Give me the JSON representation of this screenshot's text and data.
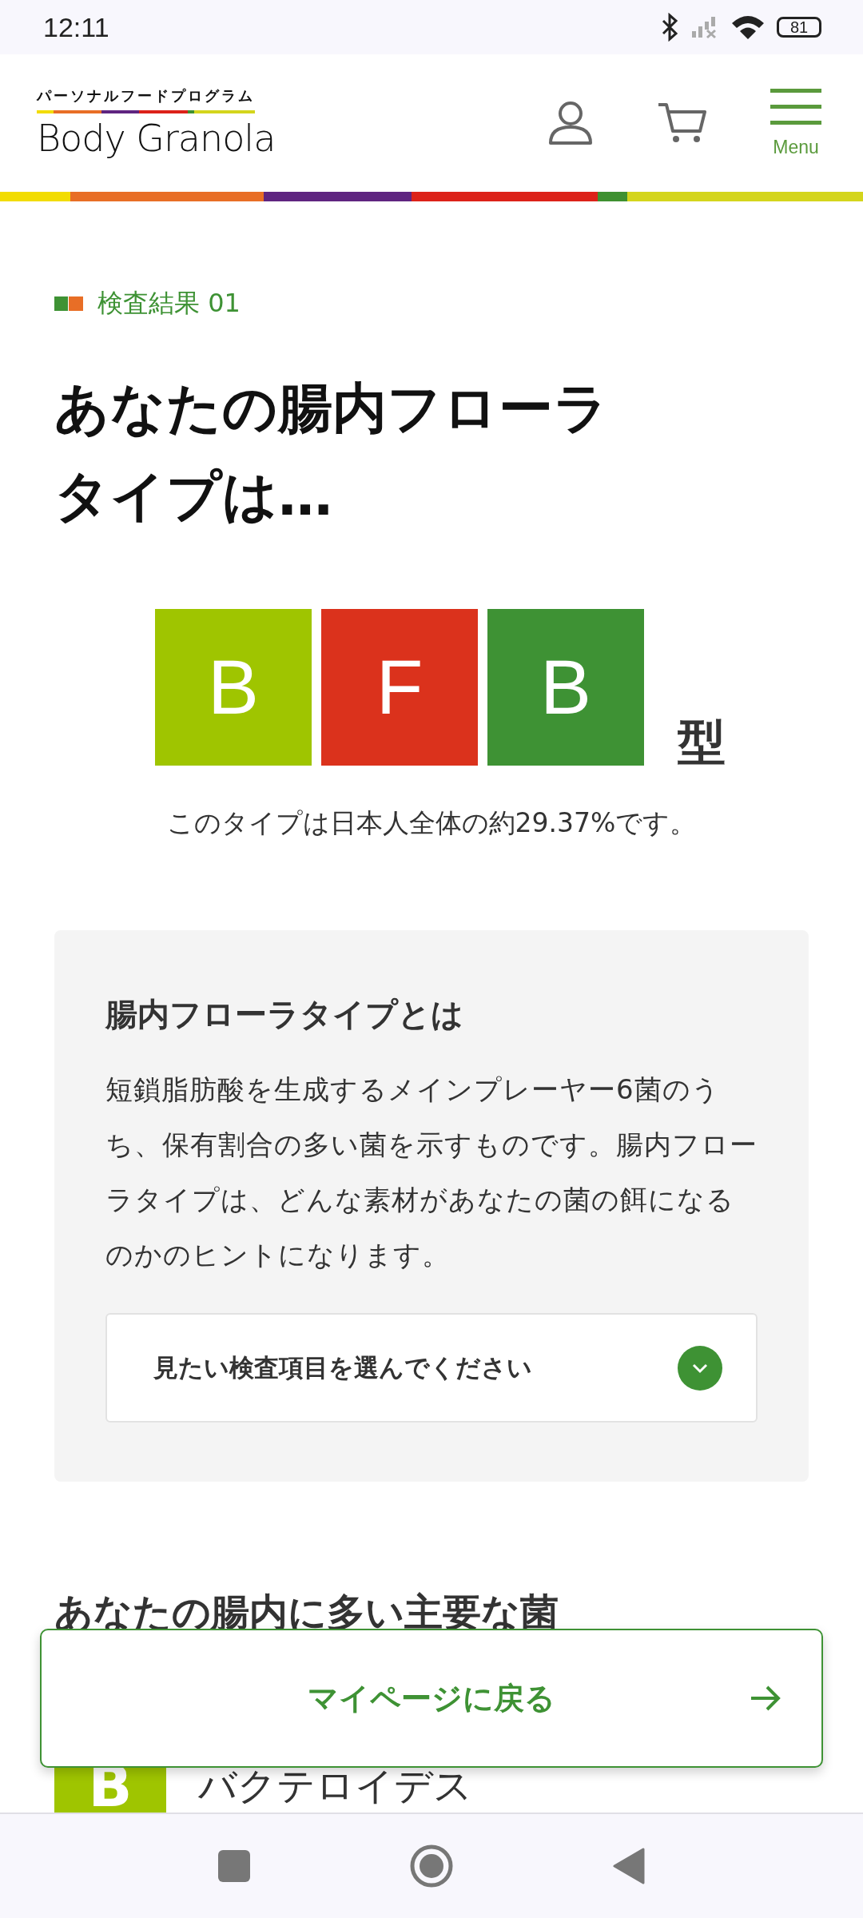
{
  "status_bar": {
    "time": "12:11",
    "battery": "81"
  },
  "header": {
    "logo_tagline": "パーソナルフードプログラム",
    "logo_name": "Body Granola",
    "menu_label": "Menu"
  },
  "result": {
    "label": "検査結果 01",
    "title_lines": [
      "あなたの腸内フローラ",
      "タイプは…"
    ],
    "type_letters": [
      {
        "letter": "B",
        "color": "#9fc500"
      },
      {
        "letter": "F",
        "color": "#db321c"
      },
      {
        "letter": "B",
        "color": "#3e9234"
      }
    ],
    "type_suffix": "型",
    "caption": "このタイプは日本人全体の約29.37%です。"
  },
  "info_box": {
    "title": "腸内フローラタイプとは",
    "body": "短鎖脂肪酸を生成するメインプレーヤー6菌のうち、保有割合の多い菌を示すものです。腸内フローラタイプは、どんな素材があなたの菌の餌になるのかのヒントになります。",
    "select": {
      "placeholder": "見たい検査項目を選んでください",
      "expanded": false
    }
  },
  "bacteria_section": {
    "title": "あなたの腸内に多い主要な菌",
    "items": [
      {
        "letter": "B",
        "color": "#9fc500",
        "name": "バクテロイデス"
      }
    ]
  },
  "floating_button": {
    "label": "マイページに戻る"
  }
}
